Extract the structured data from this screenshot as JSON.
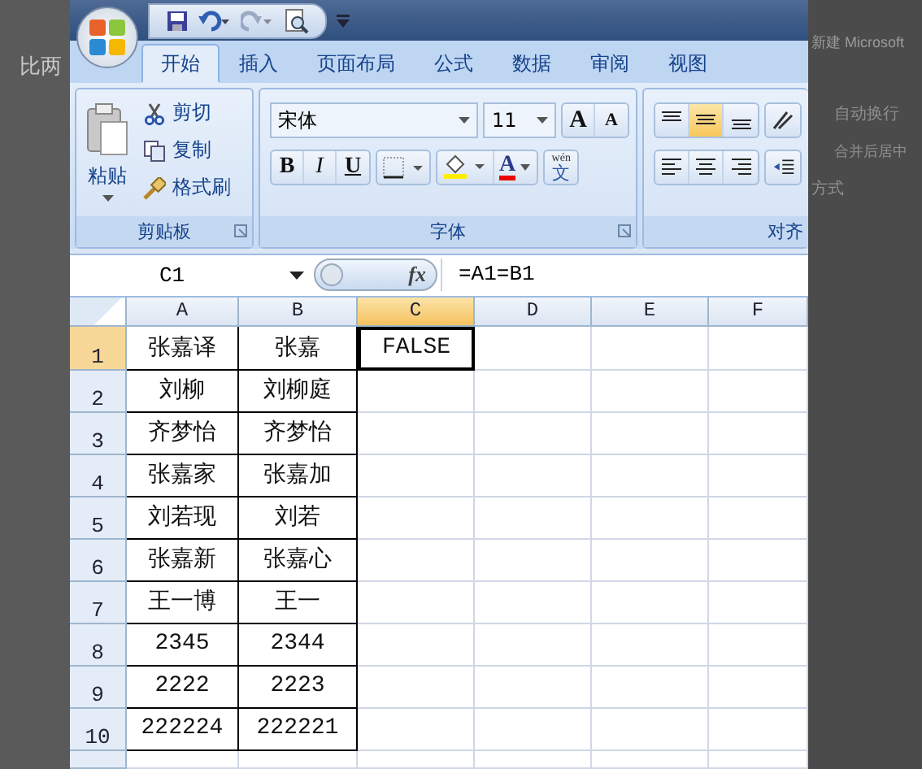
{
  "background_page": {
    "left_text": "比两",
    "right_texts": [
      "新建 Microsoft",
      "自动换行",
      "合并后居中",
      "方式"
    ]
  },
  "tabs": [
    {
      "label": "开始",
      "selected": true
    },
    {
      "label": "插入",
      "selected": false
    },
    {
      "label": "页面布局",
      "selected": false
    },
    {
      "label": "公式",
      "selected": false
    },
    {
      "label": "数据",
      "selected": false
    },
    {
      "label": "审阅",
      "selected": false
    },
    {
      "label": "视图",
      "selected": false
    }
  ],
  "clipboard_group": {
    "paste": "粘贴",
    "cut": "剪切",
    "copy": "复制",
    "format_painter": "格式刷",
    "label": "剪贴板"
  },
  "font_group": {
    "font": "宋体",
    "size": "11",
    "grow": "A",
    "shrink": "A",
    "bold": "B",
    "italic": "I",
    "underline": "U",
    "font_color": "A",
    "phonetic_top": "wén",
    "phonetic": "文",
    "label": "字体"
  },
  "alignment_group": {
    "label": "对齐",
    "middle_align_selected": true
  },
  "formula_bar": {
    "name_box": "C1",
    "fx": "fx",
    "formula": "=A1=B1"
  },
  "sheet": {
    "columns": [
      {
        "label": "A",
        "selected": false
      },
      {
        "label": "B",
        "selected": false
      },
      {
        "label": "C",
        "selected": true
      },
      {
        "label": "D",
        "selected": false
      },
      {
        "label": "E",
        "selected": false
      },
      {
        "label": "F",
        "selected": false
      }
    ],
    "rows": [
      {
        "header": "1",
        "selected": true,
        "cells": [
          {
            "value": "张嘉译"
          },
          {
            "value": "张嘉"
          },
          {
            "value": "FALSE",
            "active": true
          }
        ]
      },
      {
        "header": "2",
        "selected": false,
        "cells": [
          {
            "value": "刘柳"
          },
          {
            "value": "刘柳庭"
          }
        ]
      },
      {
        "header": "3",
        "selected": false,
        "cells": [
          {
            "value": "齐梦怡"
          },
          {
            "value": "齐梦怡"
          }
        ]
      },
      {
        "header": "4",
        "selected": false,
        "cells": [
          {
            "value": "张嘉家"
          },
          {
            "value": "张嘉加"
          }
        ]
      },
      {
        "header": "5",
        "selected": false,
        "cells": [
          {
            "value": "刘若现"
          },
          {
            "value": "刘若"
          }
        ]
      },
      {
        "header": "6",
        "selected": false,
        "cells": [
          {
            "value": "张嘉新"
          },
          {
            "value": "张嘉心"
          }
        ]
      },
      {
        "header": "7",
        "selected": false,
        "cells": [
          {
            "value": "王一博"
          },
          {
            "value": "王一"
          }
        ]
      },
      {
        "header": "8",
        "selected": false,
        "cells": [
          {
            "value": "2345"
          },
          {
            "value": "2344"
          }
        ]
      },
      {
        "header": "9",
        "selected": false,
        "cells": [
          {
            "value": "2222"
          },
          {
            "value": "2223"
          }
        ]
      },
      {
        "header": "10",
        "selected": false,
        "cells": [
          {
            "value": "222224"
          },
          {
            "value": "222221"
          }
        ]
      },
      {
        "selected": false,
        "cells": []
      }
    ]
  }
}
